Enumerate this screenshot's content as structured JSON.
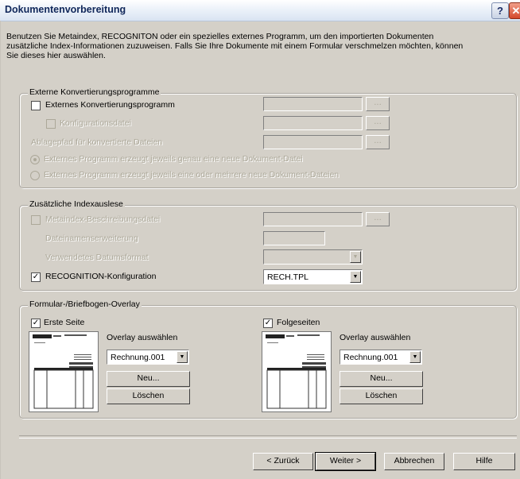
{
  "window": {
    "title": "Dokumentenvorbereitung",
    "help_icon": "question-mark",
    "close_icon": "x"
  },
  "intro_lines": [
    "Benutzen Sie Metaindex, RECOGNITON oder ein spezielles externes Programm, um den importierten Dokumenten",
    "zusätzliche Index-Informationen zuzuweisen. Falls Sie Ihre Dokumente mit einem Formular verschmelzen möchten, können",
    "Sie dieses hier auswählen."
  ],
  "external": {
    "title": "Externe Konvertierungsprogramme",
    "program_label": "Externes Konvertierungsprogramm",
    "config_label": "Konfigurationsdatei",
    "path_label": "Ablagepfad für konvertierte Dateien",
    "radio1_label": "Externes Programm erzeugt jeweils genau eine neue Dokument-Datei",
    "radio2_label": "Externes Programm erzeugt jeweils eine oder mehrere neue Dokument-Dateien",
    "browse_label": "..."
  },
  "index": {
    "title": "Zusätzliche Indexauslese",
    "metaindex_label": "Metaindex-Beschreibungsdatei",
    "ext_label": "Dateinamenserweiterung",
    "date_label": "Verwendetes Datumsformat",
    "recognition_label": "RECOGNITION-Konfiguration",
    "recognition_value": "RECH.TPL",
    "recognition_checked": "✓",
    "browse_label": "..."
  },
  "overlay": {
    "title": "Formular-/Briefbogen-Overlay",
    "first": {
      "checkbox_label": "Erste Seite",
      "checked": "✓",
      "select_label": "Overlay auswählen",
      "value": "Rechnung.001",
      "new_label": "Neu...",
      "delete_label": "Löschen"
    },
    "following": {
      "checkbox_label": "Folgeseiten",
      "checked": "✓",
      "select_label": "Overlay auswählen",
      "value": "Rechnung.001",
      "new_label": "Neu...",
      "delete_label": "Löschen"
    }
  },
  "footer": {
    "back_label": "< Zurück",
    "next_label": "Weiter >",
    "cancel_label": "Abbrechen",
    "help_label": "Hilfe"
  },
  "dropdown_arrow": "▼"
}
